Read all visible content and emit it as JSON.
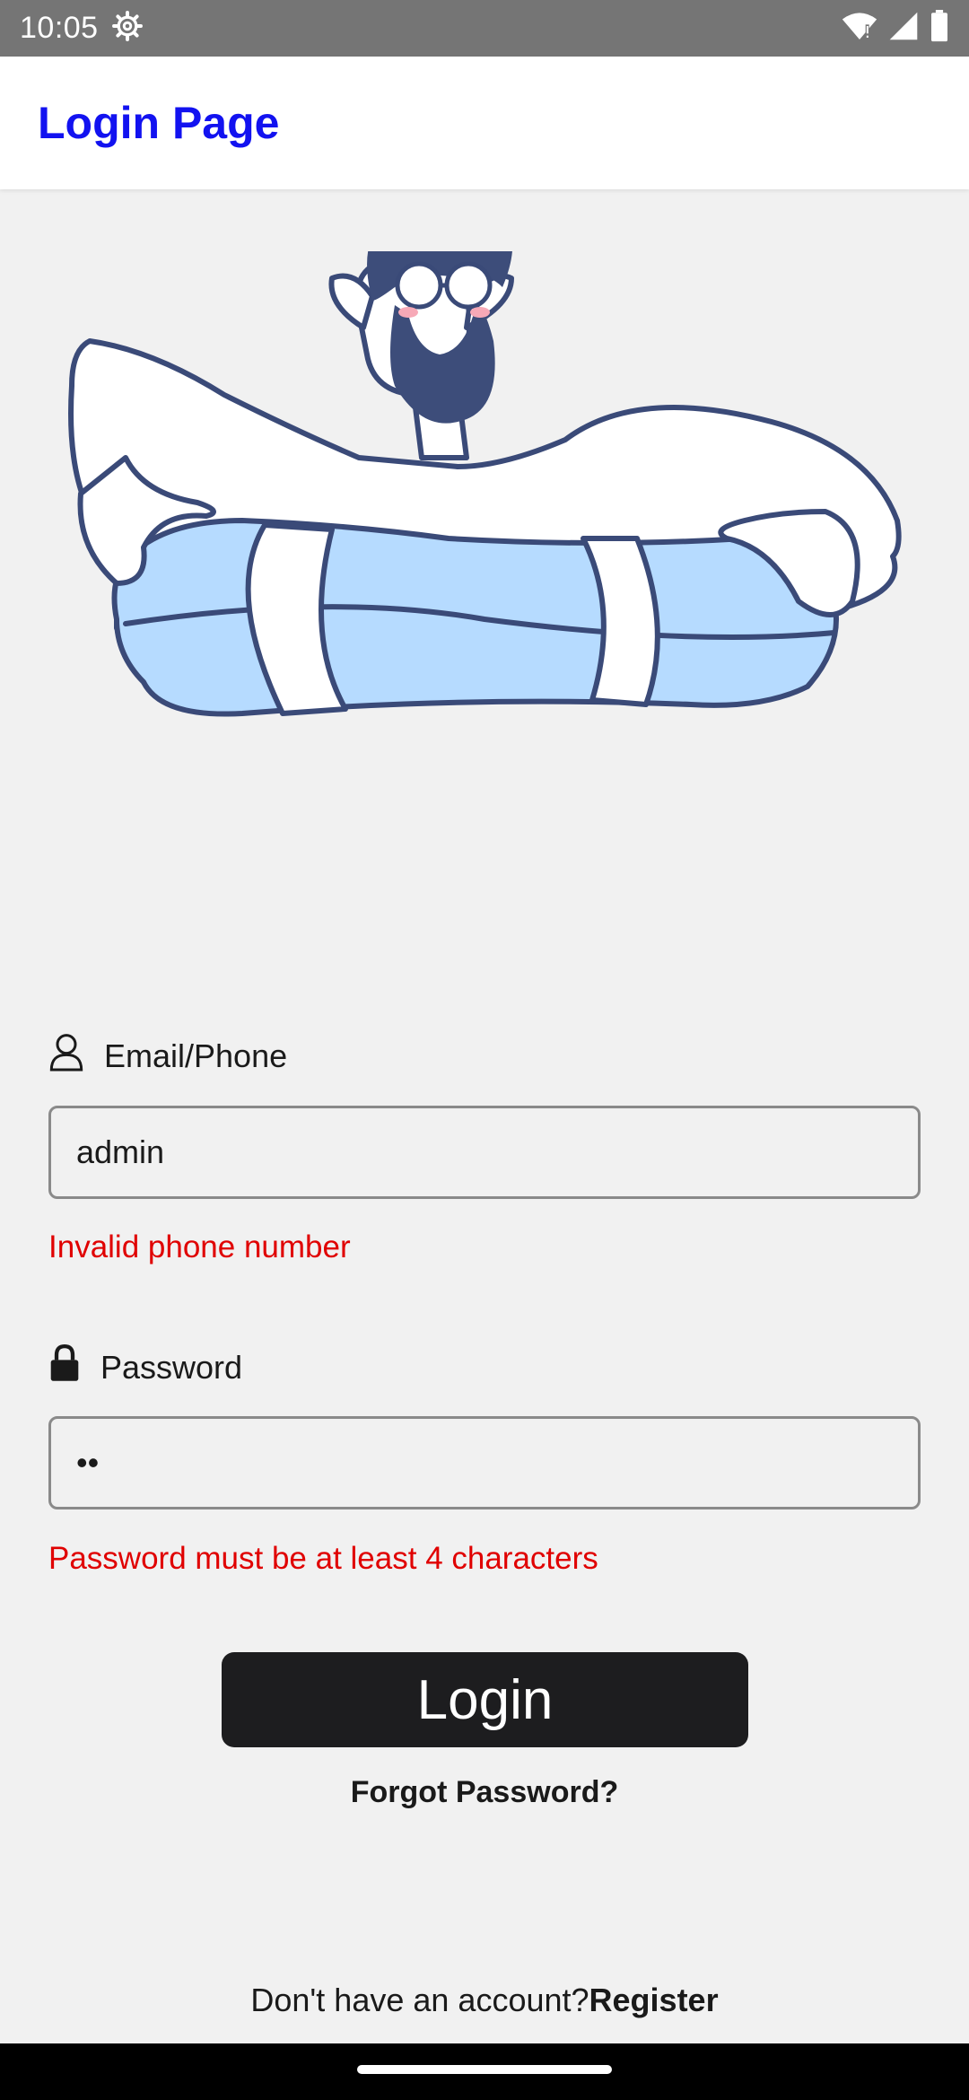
{
  "status_bar": {
    "time": "10:05",
    "icons": [
      "settings-gear-icon",
      "wifi-icon",
      "signal-icon",
      "battery-icon"
    ]
  },
  "app_bar": {
    "title": "Login Page",
    "title_color": "#1212f0"
  },
  "illustration": {
    "subject": "bearded-man-with-pillow"
  },
  "form": {
    "email": {
      "label": "Email/Phone",
      "icon": "person-icon",
      "value": "admin",
      "error": "Invalid phone number"
    },
    "password": {
      "label": "Password",
      "icon": "lock-icon",
      "value": "••",
      "error": "Password must be at least 4 characters"
    },
    "login_label": "Login",
    "forgot_label": "Forgot Password?",
    "no_account_text": "Don't have an account?",
    "register_label": "Register"
  },
  "colors": {
    "error": "#e00000",
    "button_bg": "#1d1d1f",
    "background": "#f1f1f1"
  }
}
